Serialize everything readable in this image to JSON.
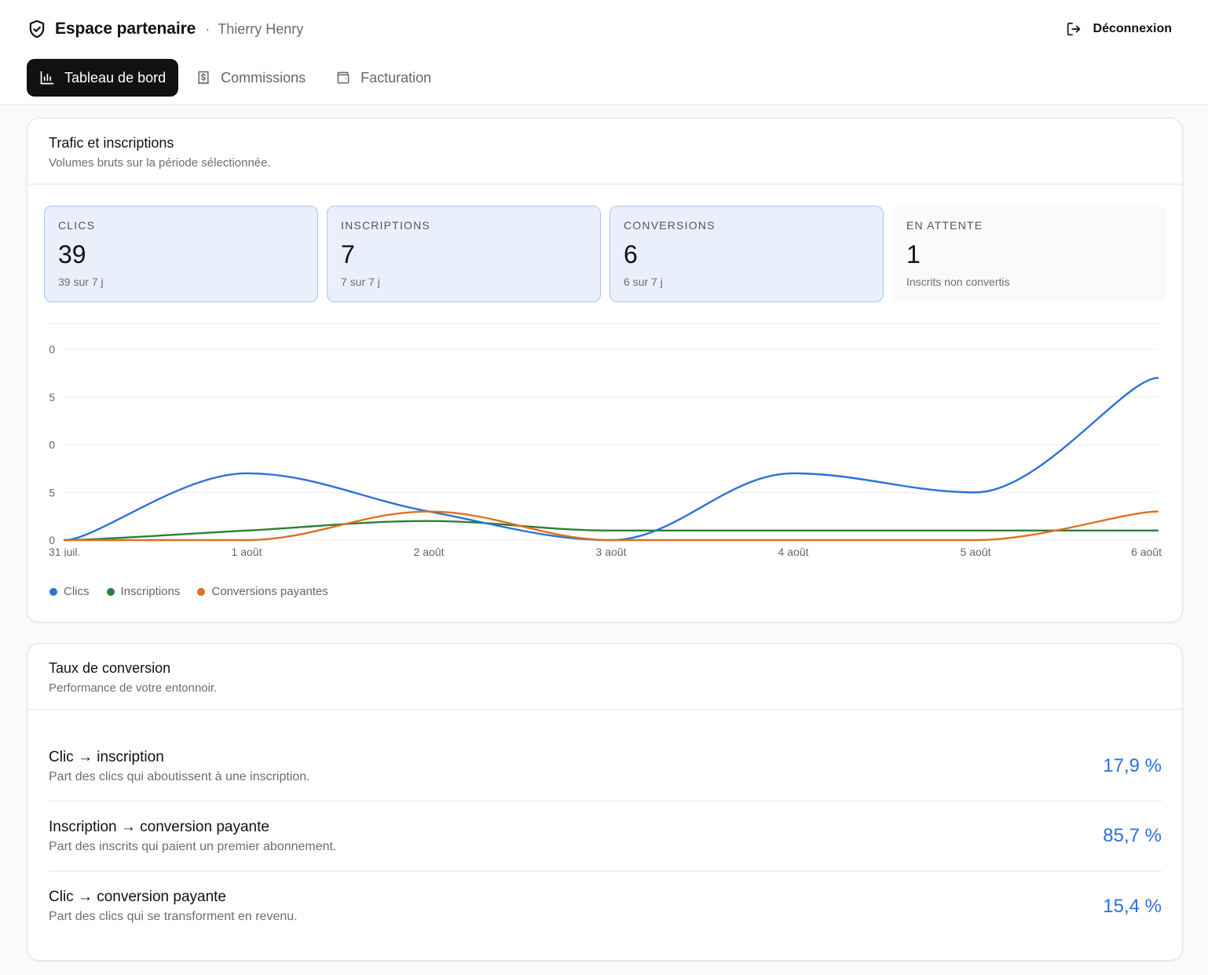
{
  "header": {
    "title": "Espace partenaire",
    "separator": "·",
    "user": "Thierry Henry",
    "logout_label": "Déconnexion"
  },
  "tabs": [
    {
      "label": "Tableau de bord",
      "icon": "bar-chart-icon",
      "active": true
    },
    {
      "label": "Commissions",
      "icon": "receipt-icon",
      "active": false
    },
    {
      "label": "Facturation",
      "icon": "wallet-icon",
      "active": false
    }
  ],
  "traffic": {
    "title": "Trafic et inscriptions",
    "subtitle": "Volumes bruts sur la période sélectionnée.",
    "stats": [
      {
        "label": "CLICS",
        "value": "39",
        "sub": "39 sur 7 j"
      },
      {
        "label": "INSCRIPTIONS",
        "value": "7",
        "sub": "7 sur 7 j"
      },
      {
        "label": "CONVERSIONS",
        "value": "6",
        "sub": "6 sur 7 j"
      },
      {
        "label": "EN ATTENTE",
        "value": "1",
        "sub": "Inscrits non convertis"
      }
    ]
  },
  "chart_data": {
    "type": "line",
    "x": [
      "31 juil.",
      "1 août",
      "2 août",
      "3 août",
      "4 août",
      "5 août",
      "6 août"
    ],
    "y_tick_labels": [
      "0",
      "5",
      "0",
      "5",
      "0"
    ],
    "ylim": [
      0,
      20
    ],
    "grid": true,
    "legend_position": "bottom-left",
    "series": [
      {
        "name": "Clics",
        "color": "#2a72d8",
        "values": [
          0,
          7,
          3,
          0,
          7,
          5,
          17
        ]
      },
      {
        "name": "Inscriptions",
        "color": "#2e7d3a",
        "values": [
          0,
          1,
          2,
          1,
          1,
          1,
          1
        ]
      },
      {
        "name": "Conversions payantes",
        "color": "#e0701c",
        "values": [
          0,
          0,
          3,
          0,
          0,
          0,
          3
        ]
      }
    ]
  },
  "rates": {
    "title": "Taux de conversion",
    "subtitle": "Performance de votre entonnoir.",
    "rows": [
      {
        "title": "Clic → inscription",
        "desc": "Part des clics qui aboutissent à une inscription.",
        "value": "17,9 %"
      },
      {
        "title": "Inscription → conversion payante",
        "desc": "Part des inscrits qui paient un premier abonnement.",
        "value": "85,7 %"
      },
      {
        "title": "Clic → conversion payante",
        "desc": "Part des clics qui se transforment en revenu.",
        "value": "15,4 %"
      }
    ]
  }
}
